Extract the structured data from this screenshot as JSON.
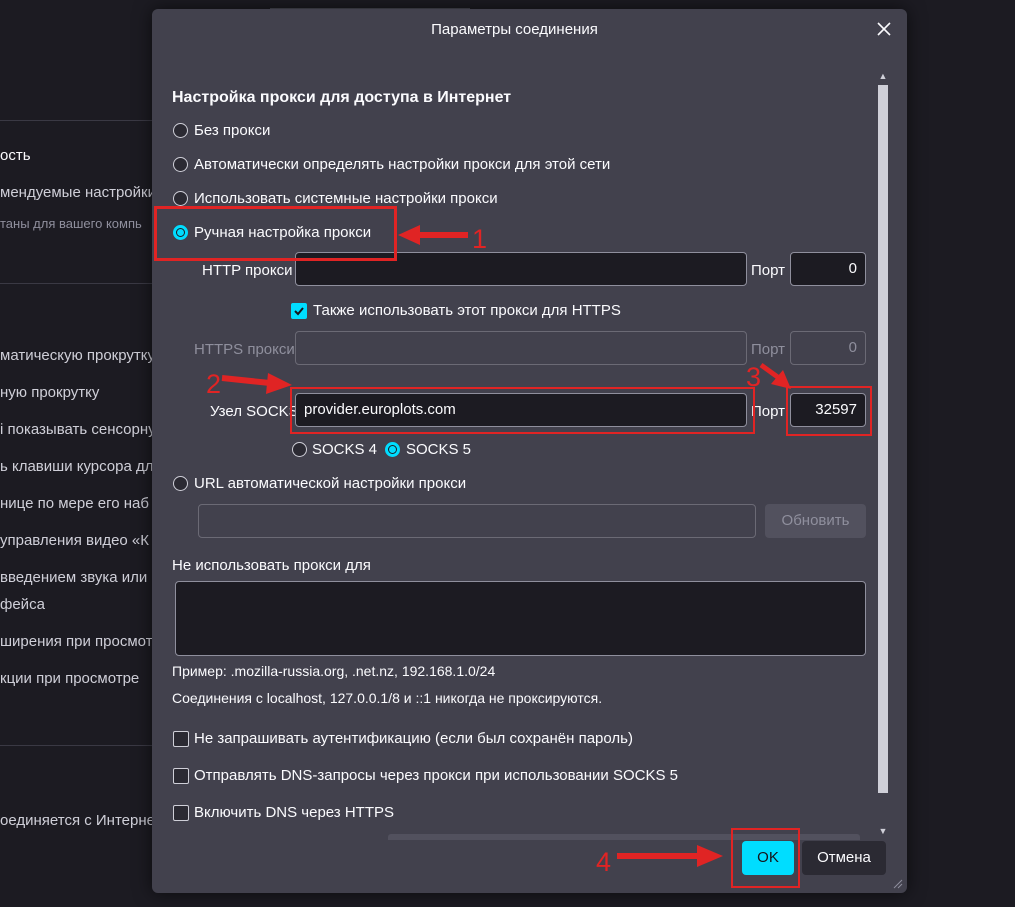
{
  "background": {
    "texts": [
      "ость",
      "мендуемые настройки",
      "таны для вашего компь",
      "матическую прокрутку",
      "ную прокрутку",
      "і показывать сенсорну",
      "ь клавиши курсора для",
      "нице по мере его наб",
      "управления видео «К",
      "введением звука или в",
      "фейса",
      "ширения при просмот",
      "кции при просмотре",
      "оединяется с Интернет"
    ]
  },
  "dialog": {
    "title": "Параметры соединения",
    "heading": "Настройка прокси для доступа в Интернет",
    "options": {
      "no_proxy": "Без прокси",
      "auto_detect": "Автоматически определять настройки прокси для этой сети",
      "system": "Использовать системные настройки прокси",
      "manual": "Ручная настройка прокси",
      "auto_url": "URL автоматической настройки прокси"
    },
    "http_proxy_label": "HTTP прокси",
    "http_proxy_value": "",
    "port_label": "Порт",
    "http_port_value": "0",
    "also_https_label": "Также использовать этот прокси для HTTPS",
    "https_proxy_label": "HTTPS прокси",
    "https_proxy_value": "",
    "https_port_value": "0",
    "socks_host_label": "Узел SOCKS",
    "socks_host_value": "provider.europlots.com",
    "socks_port_value": "32597",
    "socks4_label": "SOCKS 4",
    "socks5_label": "SOCKS 5",
    "auto_url_value": "",
    "update_button": "Обновить",
    "no_proxy_for_label": "Не использовать прокси для",
    "no_proxy_for_value": "",
    "example_text": "Пример: .mozilla-russia.org, .net.nz, 192.168.1.0/24",
    "localhost_text": "Соединения с localhost, 127.0.0.1/8 и ::1 никогда не проксируются.",
    "no_auth_prompt_label": "Не запрашивать аутентификацию (если был сохранён пароль)",
    "socks_dns_label": "Отправлять DNS-запросы через прокси при использовании SOCKS 5",
    "dns_https_label": "Включить DNS через HTTPS",
    "ok_button": "OK",
    "cancel_button": "Отмена"
  },
  "annotations": {
    "n1": "1",
    "n2": "2",
    "n3": "3",
    "n4": "4"
  },
  "colors": {
    "accent": "#00ddff",
    "annotation_red": "#e02424",
    "dialog_bg": "#42414d",
    "page_bg": "#1c1b22"
  }
}
